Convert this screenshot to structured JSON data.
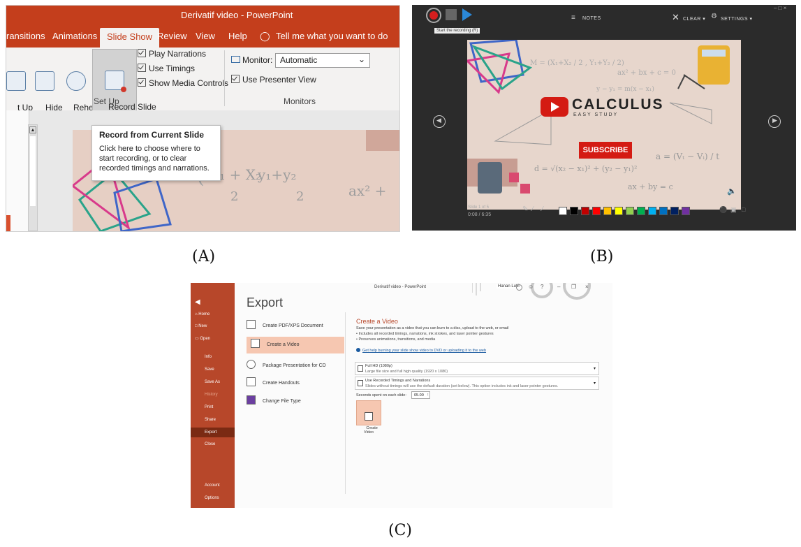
{
  "captions": {
    "a": "(A)",
    "b": "(B)",
    "c": "(C)"
  },
  "panel_a": {
    "window_title": "Derivatif video  -  PowerPoint",
    "tabs": [
      "ransitions",
      "Animations",
      "Slide Show",
      "Review",
      "View",
      "Help"
    ],
    "active_tab": "Slide Show",
    "tell_me": "Tell me what you want to do",
    "buttons": {
      "setup_show": "t Up\ne Show",
      "hide_slide": "Hide\nSlide",
      "rehearse": "Rehearse\nTimings",
      "record": "Record Slide\nShow ▾"
    },
    "checkboxes": [
      "Play Narrations",
      "Use Timings",
      "Show Media Controls"
    ],
    "setup_group": "Set Up",
    "monitor_label": "Monitor:",
    "monitor_value": "Automatic",
    "presenter_view": "Use Presenter View",
    "monitors_group": "Monitors",
    "tooltip": {
      "title": "Record from Current Slide",
      "body": "Click here to choose where to start recording, or to clear recorded timings and narrations."
    },
    "slide_math": [
      "X₁ + X₂",
      "2",
      "y₁+y₂",
      "2",
      "ax² +"
    ]
  },
  "panel_b": {
    "top_labels": {
      "notes": "NOTES",
      "clear": "CLEAR ▾",
      "settings": "SETTINGS ▾"
    },
    "record_tooltip": "Start the recording (R)",
    "slide_title": "CALCULUS",
    "slide_subtitle": "EASY STUDY",
    "subscribe": "SUBSCRIBE",
    "slide_counter": "Slide 1 of 5",
    "time": "0:08 / 6:35",
    "math": [
      "M = (X₁+X₂ / 2 , Y₁+Y₂ / 2)",
      "ax² + bx + c = 0",
      "y − y₁ = m(x − x₁)",
      "d = √(x₂ − x₁)² + (y₂ − y₁)²",
      "a = (Vₜ − Vᵢ) / t",
      "ax + by = c"
    ],
    "swatch_colors": [
      "#ffffff",
      "#000000",
      "#c00000",
      "#ff0000",
      "#ffc000",
      "#ffff00",
      "#92d050",
      "#00b050",
      "#00b0f0",
      "#0070c0",
      "#002060",
      "#7030a0"
    ]
  },
  "panel_c": {
    "window_title": "Derivatif video  -  PowerPoint",
    "user": "Hanan Lutfi",
    "backstage_nav": [
      "Home",
      "New",
      "Open",
      "Info",
      "Save",
      "Save As",
      "History",
      "Print",
      "Share",
      "Export",
      "Close",
      "Account",
      "Options"
    ],
    "active_nav": "Export",
    "heading": "Export",
    "options": [
      "Create PDF/XPS Document",
      "Create a Video",
      "Package Presentation for CD",
      "Create Handouts",
      "Change File Type"
    ],
    "selected_option": "Create a Video",
    "cv_title": "Create a Video",
    "cv_desc": "Save your presentation as a video that you can burn to a disc, upload to the web, or email",
    "cv_bullets": [
      "Includes all recorded timings, narrations, ink strokes, and laser pointer gestures",
      "Preserves animations, transitions, and media"
    ],
    "cv_help": "Get help burning your slide show video to DVD or uploading it to the web",
    "quality_title": "Full HD (1080p)",
    "quality_desc": "Large file size and full high quality (1920 x 1080)",
    "timings_title": "Use Recorded Timings and Narrations",
    "timings_desc": "Slides without timings will use the default duration (set below). This option includes ink and laser pointer gestures.",
    "seconds_label": "Seconds spent on each slide:",
    "seconds_value": "05.00",
    "create_btn": "Create\nVideo"
  }
}
